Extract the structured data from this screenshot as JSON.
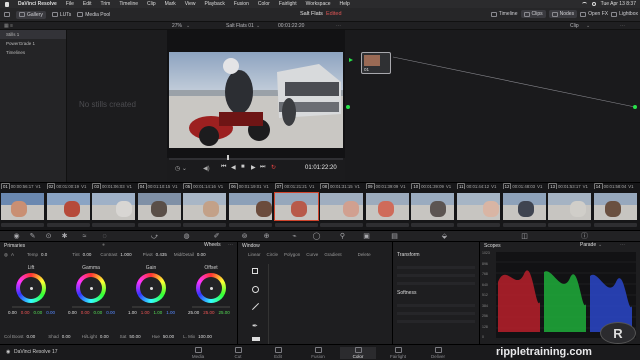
{
  "menubar": {
    "app_name": "DaVinci Resolve",
    "items": [
      "File",
      "Edit",
      "Trim",
      "Timeline",
      "Clip",
      "Mark",
      "View",
      "Playback",
      "Fusion",
      "Color",
      "Fairlight",
      "Workspace",
      "Help"
    ],
    "clock": "Tue Apr 13 8:37"
  },
  "toolbar": {
    "gallery": "Gallery",
    "luts": "LUTs",
    "media_pool": "Media Pool",
    "project_title": "Salt Flats",
    "edited_label": "Edited",
    "timeline": "Timeline",
    "clips": "Clips",
    "nodes": "Nodes",
    "open_fx": "Open FX",
    "lightbox": "Lightbox"
  },
  "subbar": {
    "zoom": "27%",
    "timeline_name": "Salt Flats 01",
    "timecode": "00:01:22:20",
    "clip_label": "Clip"
  },
  "gallery": {
    "items": [
      "Stills 1",
      "PowerGrade 1",
      "Timelines"
    ],
    "empty_text": "No stills created"
  },
  "viewer": {
    "timecode": "01:01:22:20"
  },
  "node": {
    "label": "01"
  },
  "clips": [
    {
      "num": "01",
      "tc": "00:00:56:17",
      "track": "V1"
    },
    {
      "num": "02",
      "tc": "00:01:00:19",
      "track": "V1"
    },
    {
      "num": "03",
      "tc": "00:01:06:03",
      "track": "V1"
    },
    {
      "num": "04",
      "tc": "00:01:10:15",
      "track": "V1"
    },
    {
      "num": "05",
      "tc": "00:01:14:16",
      "track": "V1"
    },
    {
      "num": "06",
      "tc": "00:01:19:01",
      "track": "V1"
    },
    {
      "num": "07",
      "tc": "00:01:21:21",
      "track": "V1"
    },
    {
      "num": "08",
      "tc": "00:01:31:15",
      "track": "V1"
    },
    {
      "num": "09",
      "tc": "00:01:39:09",
      "track": "V1"
    },
    {
      "num": "10",
      "tc": "00:01:39:09",
      "track": "V1"
    },
    {
      "num": "11",
      "tc": "00:01:44:12",
      "track": "V1"
    },
    {
      "num": "12",
      "tc": "00:01:48:03",
      "track": "V1"
    },
    {
      "num": "13",
      "tc": "00:01:53:17",
      "track": "V1"
    },
    {
      "num": "14",
      "tc": "00:01:58:04",
      "track": "V1"
    }
  ],
  "primaries": {
    "title": "Primaries",
    "temp_label": "Temp",
    "temp": "0.0",
    "tint_label": "Tint",
    "tint": "0.00",
    "contrast_label": "Contrast",
    "contrast": "1.000",
    "pivot_label": "Pivot",
    "pivot": "0.435",
    "middetail_label": "Mid/Detail",
    "middetail": "0.00",
    "wheels_label": "Wheels",
    "wheels": [
      {
        "name": "Lift",
        "vals": [
          "0.00",
          "0.00",
          "0.00",
          "0.00"
        ]
      },
      {
        "name": "Gamma",
        "vals": [
          "0.00",
          "0.00",
          "0.00",
          "0.00"
        ]
      },
      {
        "name": "Gain",
        "vals": [
          "1.00",
          "1.00",
          "1.00",
          "1.00"
        ]
      },
      {
        "name": "Offset",
        "vals": [
          "25.00",
          "25.00",
          "25.00"
        ]
      }
    ],
    "colboost_label": "Col Boost",
    "colboost": "0.00",
    "shad_label": "Shad",
    "shad": "0.00",
    "hilight_label": "Hi/Light",
    "hilight": "0.00",
    "sat_label": "Sat",
    "sat": "50.00",
    "hue_label": "Hue",
    "hue": "50.00",
    "lmix_label": "L. Mix",
    "lmix": "100.00"
  },
  "window": {
    "title": "Window",
    "shapes": [
      "Linear",
      "Circle",
      "Polygon",
      "Curve",
      "Gradient"
    ],
    "delete": "Delete"
  },
  "transform": {
    "title": "Transform",
    "softness": "Softness"
  },
  "scopes": {
    "title": "Scopes",
    "mode": "Parade",
    "ticks": [
      "1023",
      "896",
      "768",
      "640",
      "512",
      "384",
      "256",
      "128",
      "0"
    ]
  },
  "pages": {
    "version": "DaVinci Resolve 17",
    "items": [
      "Media",
      "Cut",
      "Edit",
      "Fusion",
      "Color",
      "Fairlight",
      "Deliver"
    ],
    "watermark": "rippletraining.com"
  }
}
